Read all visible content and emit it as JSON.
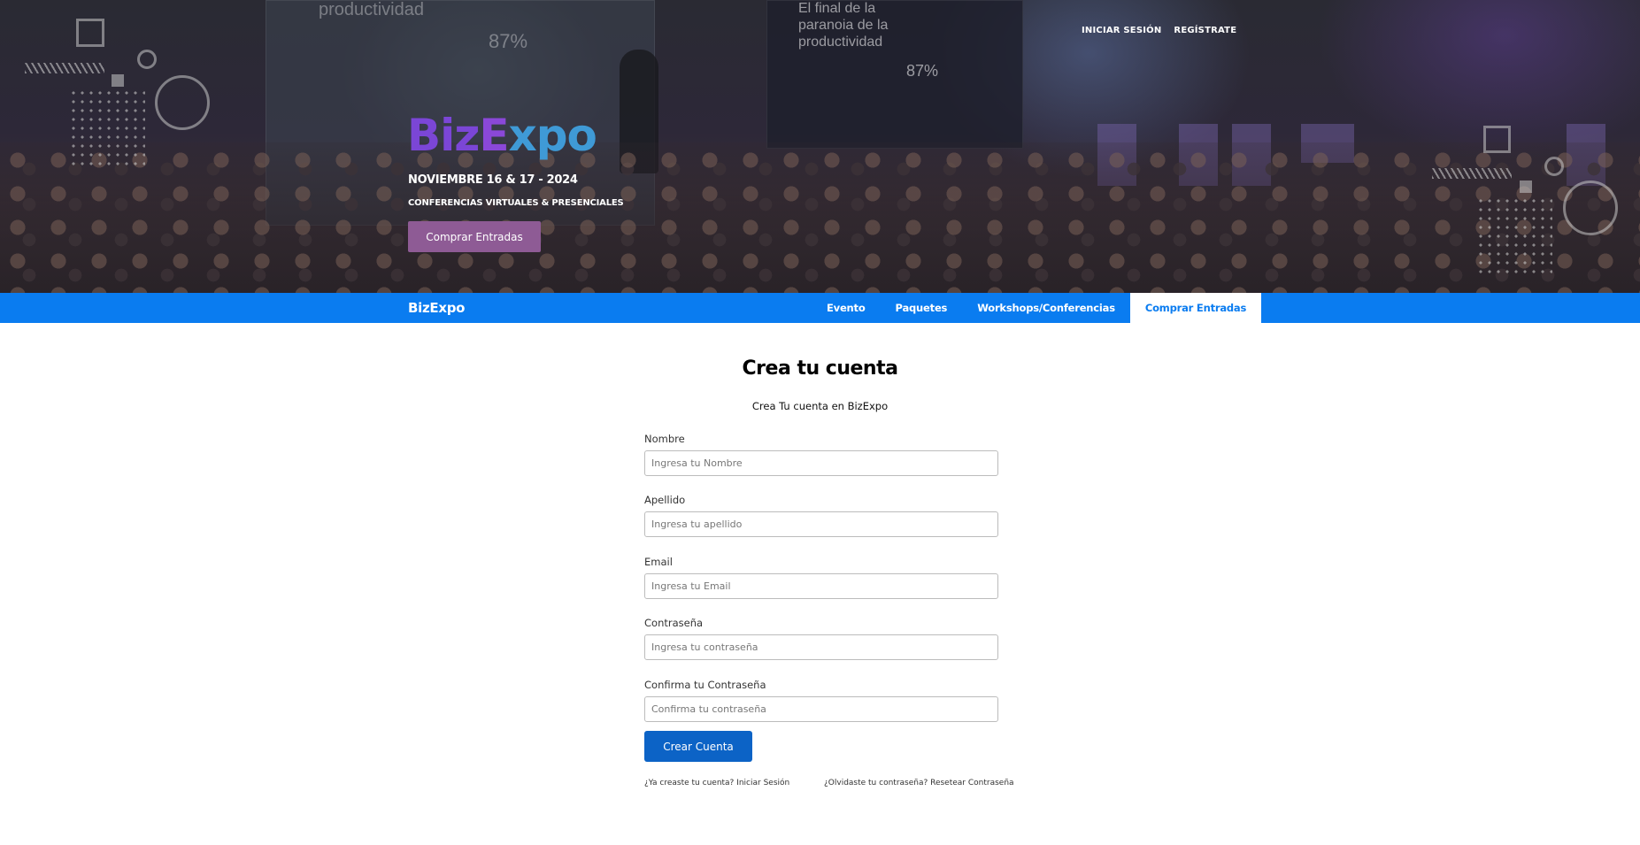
{
  "hero": {
    "top_nav": {
      "login": "INICIAR SESIÓN",
      "register": "REGÍSTRATE"
    },
    "logo": {
      "part_biz": "Biz",
      "part_e": "E",
      "part_xpo": "xpo"
    },
    "date": "NOVIEMBRE 16 & 17 - 2024",
    "subtitle": "CONFERENCIAS VIRTUALES & PRESENCIALES",
    "cta": "Comprar Entradas",
    "background_text": {
      "screen_left_1": "productividad",
      "screen_left_2": "87%",
      "screen_right_1": "El final de la paranoia de la productividad",
      "screen_right_2": "87%"
    }
  },
  "navbar": {
    "brand": "BizExpo",
    "links": [
      {
        "label": "Evento"
      },
      {
        "label": "Paquetes"
      },
      {
        "label": "Workshops/Conferencias"
      },
      {
        "label": "Comprar Entradas",
        "active": true
      }
    ]
  },
  "form": {
    "title": "Crea tu cuenta",
    "subtitle": "Crea Tu cuenta en BizExpo",
    "fields": [
      {
        "label": "Nombre",
        "placeholder": "Ingresa tu Nombre"
      },
      {
        "label": "Apellido",
        "placeholder": "Ingresa tu apellido"
      },
      {
        "label": "Email",
        "placeholder": "Ingresa tu Email"
      },
      {
        "label": "Contraseña",
        "placeholder": "Ingresa tu contraseña"
      },
      {
        "label": "Confirma tu Contraseña",
        "placeholder": "Confirma tu contraseña"
      }
    ],
    "submit": "Crear Cuenta",
    "link_login": "¿Ya creaste tu cuenta? Iniciar Sesión",
    "link_reset": "¿Olvidaste tu contraseña? Resetear Contraseña"
  },
  "colors": {
    "navbar_bg": "#0a7cf0",
    "hero_button": "#8e5b95",
    "submit_button": "#0c63c6",
    "logo_purple": "#7b46d6",
    "logo_blue": "#3f9ad6"
  }
}
